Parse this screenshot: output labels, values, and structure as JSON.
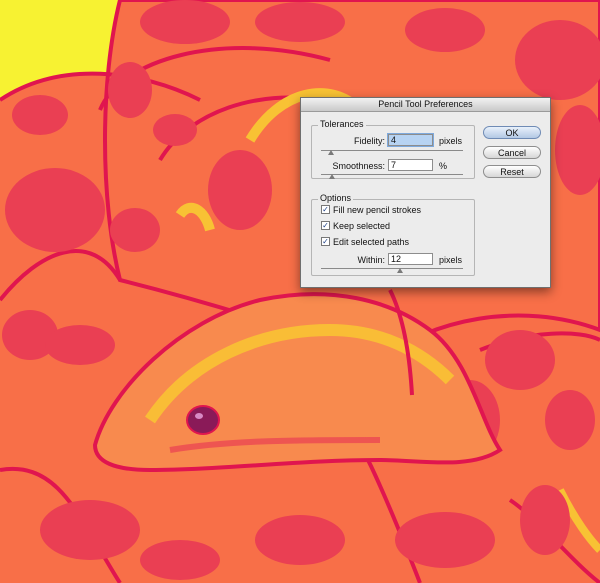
{
  "dialog": {
    "title": "Pencil Tool Preferences",
    "tolerances": {
      "legend": "Tolerances",
      "fidelity_label": "Fidelity:",
      "fidelity_value": "4",
      "fidelity_unit": "pixels",
      "smoothness_label": "Smoothness:",
      "smoothness_value": "7",
      "smoothness_unit": "%"
    },
    "options": {
      "legend": "Options",
      "fill_new_strokes": {
        "label": "Fill new pencil strokes",
        "checked": true
      },
      "keep_selected": {
        "label": "Keep selected",
        "checked": true
      },
      "edit_selected_paths": {
        "label": "Edit selected paths",
        "checked": true
      },
      "within_label": "Within:",
      "within_value": "12",
      "within_unit": "pixels"
    },
    "buttons": {
      "ok": "OK",
      "cancel": "Cancel",
      "reset": "Reset"
    }
  },
  "colors": {
    "background_yellow": "#f7f232",
    "snake_orange": "#f86f48",
    "snake_spots": "#ea3f53",
    "outline": "#e0154f",
    "highlight_yellow": "#f8c234",
    "eye": "#8a1a58"
  }
}
